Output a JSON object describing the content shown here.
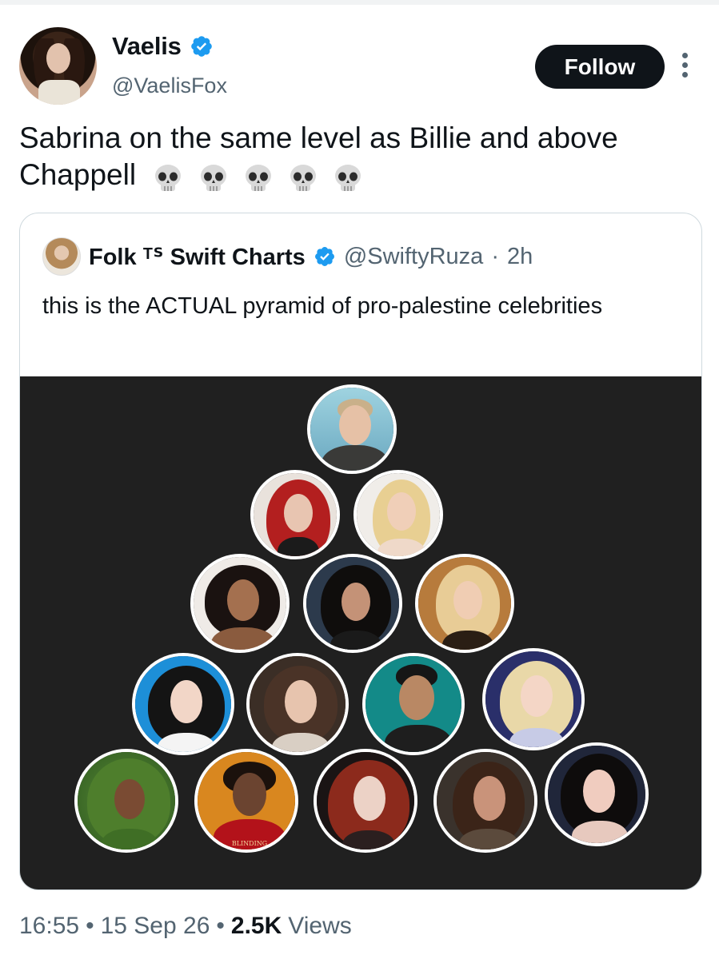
{
  "author": {
    "display_name": "Vaelis",
    "handle": "@VaelisFox",
    "verified": true
  },
  "actions": {
    "follow_label": "Follow",
    "more_icon": "more-vertical-icon"
  },
  "tweet": {
    "text": "Sabrina on the same level as Billie and above Chappell",
    "emoji": [
      "💀",
      "💀",
      "💀",
      "💀",
      "💀"
    ]
  },
  "quoted_tweet": {
    "display_name": "Folk ᵀᔆ Swift Charts",
    "verified": true,
    "handle": "@SwiftyRuza",
    "separator": "·",
    "age": "2h",
    "text": "this is the ACTUAL pyramid of pro-palestine celebrities"
  },
  "pyramid": {
    "rows": [
      1,
      2,
      3,
      4,
      5
    ],
    "portrait_count": 15,
    "album_caption": "BLINDING"
  },
  "meta": {
    "time": "16:55",
    "dot": "•",
    "date": "15 Sep 26",
    "views_count": "2.5K",
    "views_label": "Views"
  },
  "colors": {
    "verified_blue": "#1d9bf0",
    "text_primary": "#0f1419",
    "text_secondary": "#536471",
    "card_border": "#cfd9de",
    "image_background": "#202020"
  }
}
